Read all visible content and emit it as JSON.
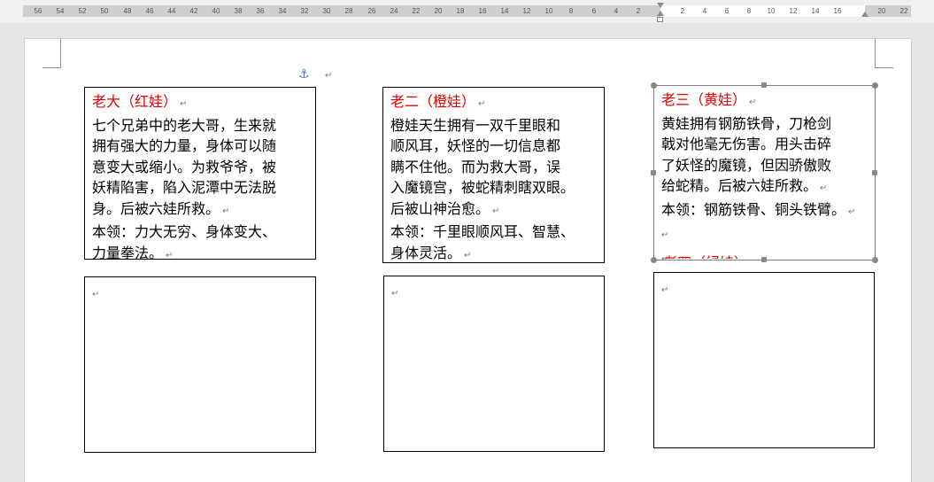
{
  "ruler": {
    "left_numbers": [
      "56",
      "54",
      "52",
      "50",
      "48",
      "46",
      "44",
      "42",
      "40",
      "38",
      "36",
      "34",
      "32",
      "30",
      "28",
      "26",
      "24",
      "22",
      "20",
      "18",
      "16",
      "14",
      "12",
      "10",
      "8",
      "6",
      "4",
      "2"
    ],
    "right_numbers": [
      "2",
      "4",
      "6",
      "8",
      "10",
      "12",
      "14",
      "16"
    ],
    "far_right_numbers": [
      "20",
      "22"
    ]
  },
  "paragraph_mark": "↵",
  "anchor_icon": "⚓",
  "boxes": [
    {
      "title": "老大（红娃）",
      "lines": [
        "七个兄弟中的老大哥，生来就",
        "拥有强大的力量，身体可以随",
        "意变大或缩小。为救爷爷，被",
        "妖精陷害，陷入泥潭中无法脱",
        "身。后被六娃所救。"
      ],
      "skill": [
        "本领：力大无穷、身体变大、",
        "力量拳法。"
      ]
    },
    {
      "title": "老二（橙娃）",
      "lines": [
        "橙娃天生拥有一双千里眼和",
        "顺风耳，妖怪的一切信息都",
        "瞒不住他。而为救大哥，误",
        "入魔镜宫，被蛇精刺瞎双眼。",
        "后被山神治愈。"
      ],
      "skill": [
        "本领：千里眼顺风耳、智慧、",
        "身体灵活。"
      ]
    },
    {
      "title": "老三（黄娃）",
      "lines": [
        "黄娃拥有钢筋铁骨，刀枪剑",
        "戟对他毫无伤害。用头击碎",
        "了妖怪的魔镜，但因骄傲败",
        "给蛇精。后被六娃所救。"
      ],
      "skill": [
        "本领：钢筋铁骨、铜头铁臂。"
      ],
      "overflow_title": "老四（绿娃）"
    }
  ]
}
